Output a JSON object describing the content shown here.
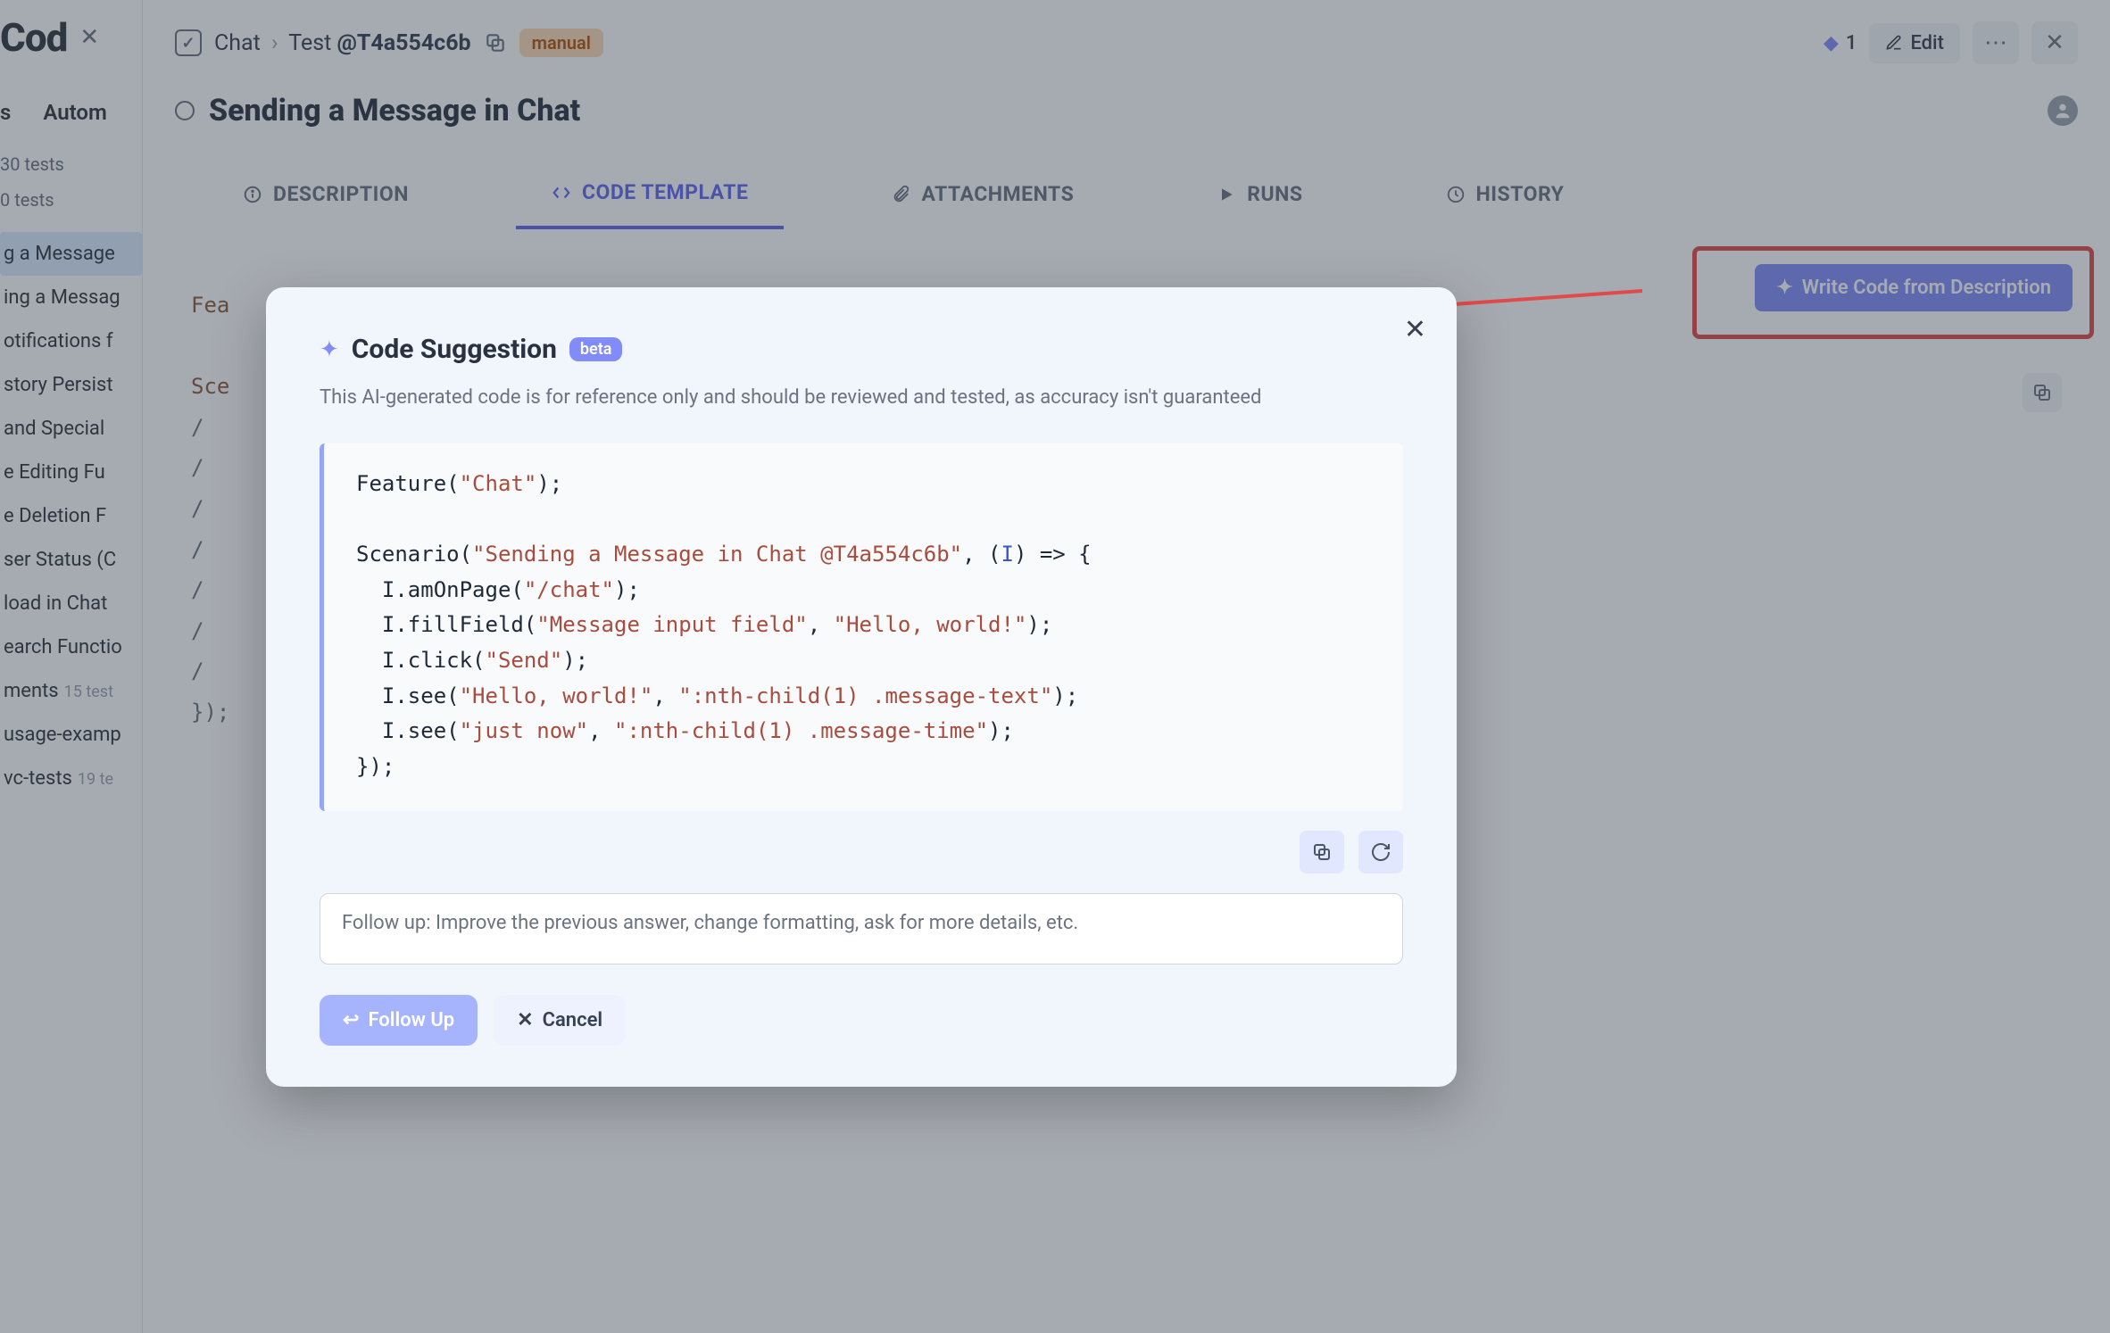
{
  "sidebar": {
    "title": "Cod",
    "tabs": {
      "left": "s",
      "right": "Autom"
    },
    "meta1": "30 tests",
    "meta2": "0 tests",
    "items": [
      {
        "label": "g a Message",
        "active": true
      },
      {
        "label": "ing a Messag"
      },
      {
        "label": "otifications f"
      },
      {
        "label": "story Persist"
      },
      {
        "label": "and Special"
      },
      {
        "label": "e Editing Fu"
      },
      {
        "label": "e Deletion F"
      },
      {
        "label": "ser Status (C"
      },
      {
        "label": "load in Chat"
      },
      {
        "label": "earch Functio"
      },
      {
        "label": "ments",
        "count": "15 test"
      },
      {
        "label": "usage-examp"
      },
      {
        "label": "vc-tests",
        "count": "19 te"
      }
    ]
  },
  "topbar": {
    "crumb1": "Chat",
    "crumb2": "Test",
    "test_id": "@T4a554c6b",
    "tag": "manual",
    "count": "1",
    "edit": "Edit"
  },
  "page": {
    "title": "Sending a Message in Chat"
  },
  "tabs": {
    "description": "DESCRIPTION",
    "code_template": "CODE TEMPLATE",
    "attachments": "ATTACHMENTS",
    "runs": "RUNS",
    "history": "HISTORY"
  },
  "write_button": "Write Code from Description",
  "bg_code": {
    "l1a": "Fea",
    "l2a": "Sce",
    "l3": "  /",
    "l4": "  /",
    "l5": "  /",
    "l6": "  /",
    "l7": "  /",
    "l8": "  /",
    "l9": "  /",
    "l10": "});"
  },
  "modal": {
    "title": "Code Suggestion",
    "beta": "beta",
    "subtitle": "This AI-generated code is for reference only and should be reviewed and tested, as accuracy isn't guaranteed",
    "code": {
      "l1": {
        "fn": "Feature",
        "s1": "\"Chat\"",
        "end": ");"
      },
      "l3": {
        "fn": "Scenario",
        "s1": "\"Sending a Message in Chat @T4a554c6b\"",
        "mid": ", (",
        "p": "I",
        "end": ") => {"
      },
      "l4": {
        "pre": "  I.amOnPage(",
        "s1": "\"/chat\"",
        "end": ");"
      },
      "l5": {
        "pre": "  I.fillField(",
        "s1": "\"Message input field\"",
        "c": ", ",
        "s2": "\"Hello, world!\"",
        "end": ");"
      },
      "l6": {
        "pre": "  I.click(",
        "s1": "\"Send\"",
        "end": ");"
      },
      "l7": {
        "pre": "  I.see(",
        "s1": "\"Hello, world!\"",
        "c": ", ",
        "s2": "\":nth-child(1) .message-text\"",
        "end": ");"
      },
      "l8": {
        "pre": "  I.see(",
        "s1": "\"just now\"",
        "c": ", ",
        "s2": "\":nth-child(1) .message-time\"",
        "end": ");"
      },
      "l9": "});"
    },
    "placeholder": "Follow up: Improve the previous answer, change formatting, ask for more details, etc.",
    "follow_up": "Follow Up",
    "cancel": "Cancel"
  },
  "colors": {
    "accent": "#818cf8",
    "highlight": "#e04a4a"
  }
}
